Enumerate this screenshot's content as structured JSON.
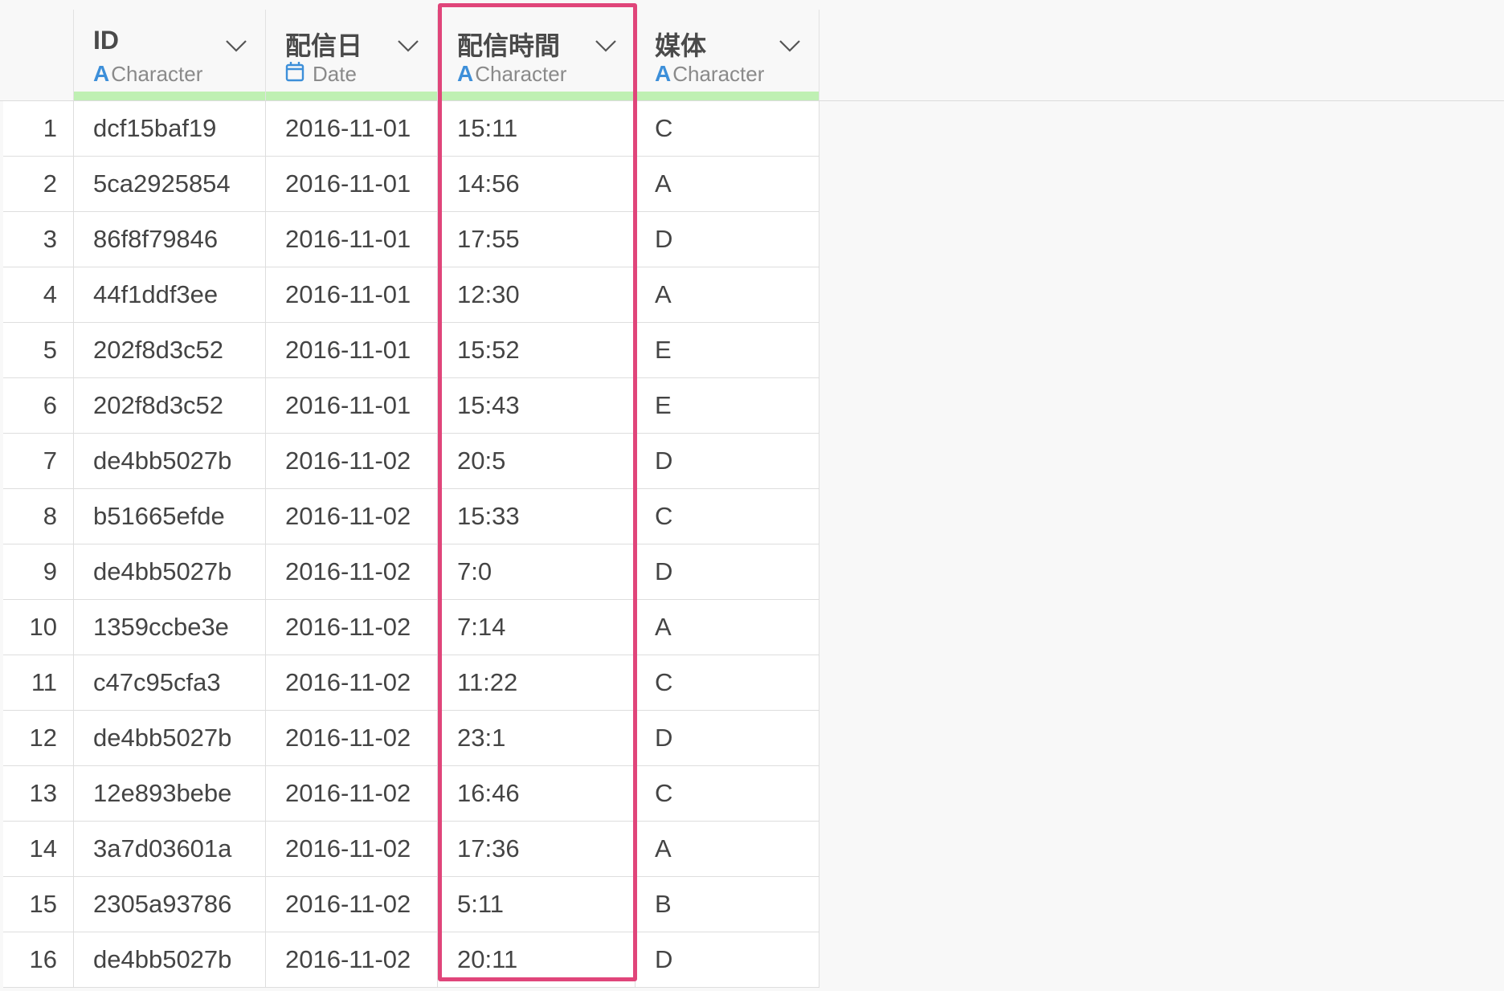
{
  "columns": [
    {
      "name": "ID",
      "type": "Character",
      "type_icon": "character-type-icon"
    },
    {
      "name": "配信日",
      "type": "Date",
      "type_icon": "calendar-icon"
    },
    {
      "name": "配信時間",
      "type": "Character",
      "type_icon": "character-type-icon"
    },
    {
      "name": "媒体",
      "type": "Character",
      "type_icon": "character-type-icon"
    }
  ],
  "type_letter": "A",
  "rows": [
    {
      "n": "1",
      "id": "dcf15baf19",
      "date": "2016-11-01",
      "time": "15:11",
      "media": "C"
    },
    {
      "n": "2",
      "id": "5ca2925854",
      "date": "2016-11-01",
      "time": "14:56",
      "media": "A"
    },
    {
      "n": "3",
      "id": "86f8f79846",
      "date": "2016-11-01",
      "time": "17:55",
      "media": "D"
    },
    {
      "n": "4",
      "id": "44f1ddf3ee",
      "date": "2016-11-01",
      "time": "12:30",
      "media": "A"
    },
    {
      "n": "5",
      "id": "202f8d3c52",
      "date": "2016-11-01",
      "time": "15:52",
      "media": "E"
    },
    {
      "n": "6",
      "id": "202f8d3c52",
      "date": "2016-11-01",
      "time": "15:43",
      "media": "E"
    },
    {
      "n": "7",
      "id": "de4bb5027b",
      "date": "2016-11-02",
      "time": "20:5",
      "media": "D"
    },
    {
      "n": "8",
      "id": "b51665efde",
      "date": "2016-11-02",
      "time": "15:33",
      "media": "C"
    },
    {
      "n": "9",
      "id": "de4bb5027b",
      "date": "2016-11-02",
      "time": "7:0",
      "media": "D"
    },
    {
      "n": "10",
      "id": "1359ccbe3e",
      "date": "2016-11-02",
      "time": "7:14",
      "media": "A"
    },
    {
      "n": "11",
      "id": "c47c95cfa3",
      "date": "2016-11-02",
      "time": "11:22",
      "media": "C"
    },
    {
      "n": "12",
      "id": "de4bb5027b",
      "date": "2016-11-02",
      "time": "23:1",
      "media": "D"
    },
    {
      "n": "13",
      "id": "12e893bebe",
      "date": "2016-11-02",
      "time": "16:46",
      "media": "C"
    },
    {
      "n": "14",
      "id": "3a7d03601a",
      "date": "2016-11-02",
      "time": "17:36",
      "media": "A"
    },
    {
      "n": "15",
      "id": "2305a93786",
      "date": "2016-11-02",
      "time": "5:11",
      "media": "B"
    },
    {
      "n": "16",
      "id": "de4bb5027b",
      "date": "2016-11-02",
      "time": "20:11",
      "media": "D"
    }
  ],
  "colors": {
    "highlight": "#e0457a",
    "header_accent": "#bff0b3",
    "type_icon": "#3d8fd9"
  }
}
